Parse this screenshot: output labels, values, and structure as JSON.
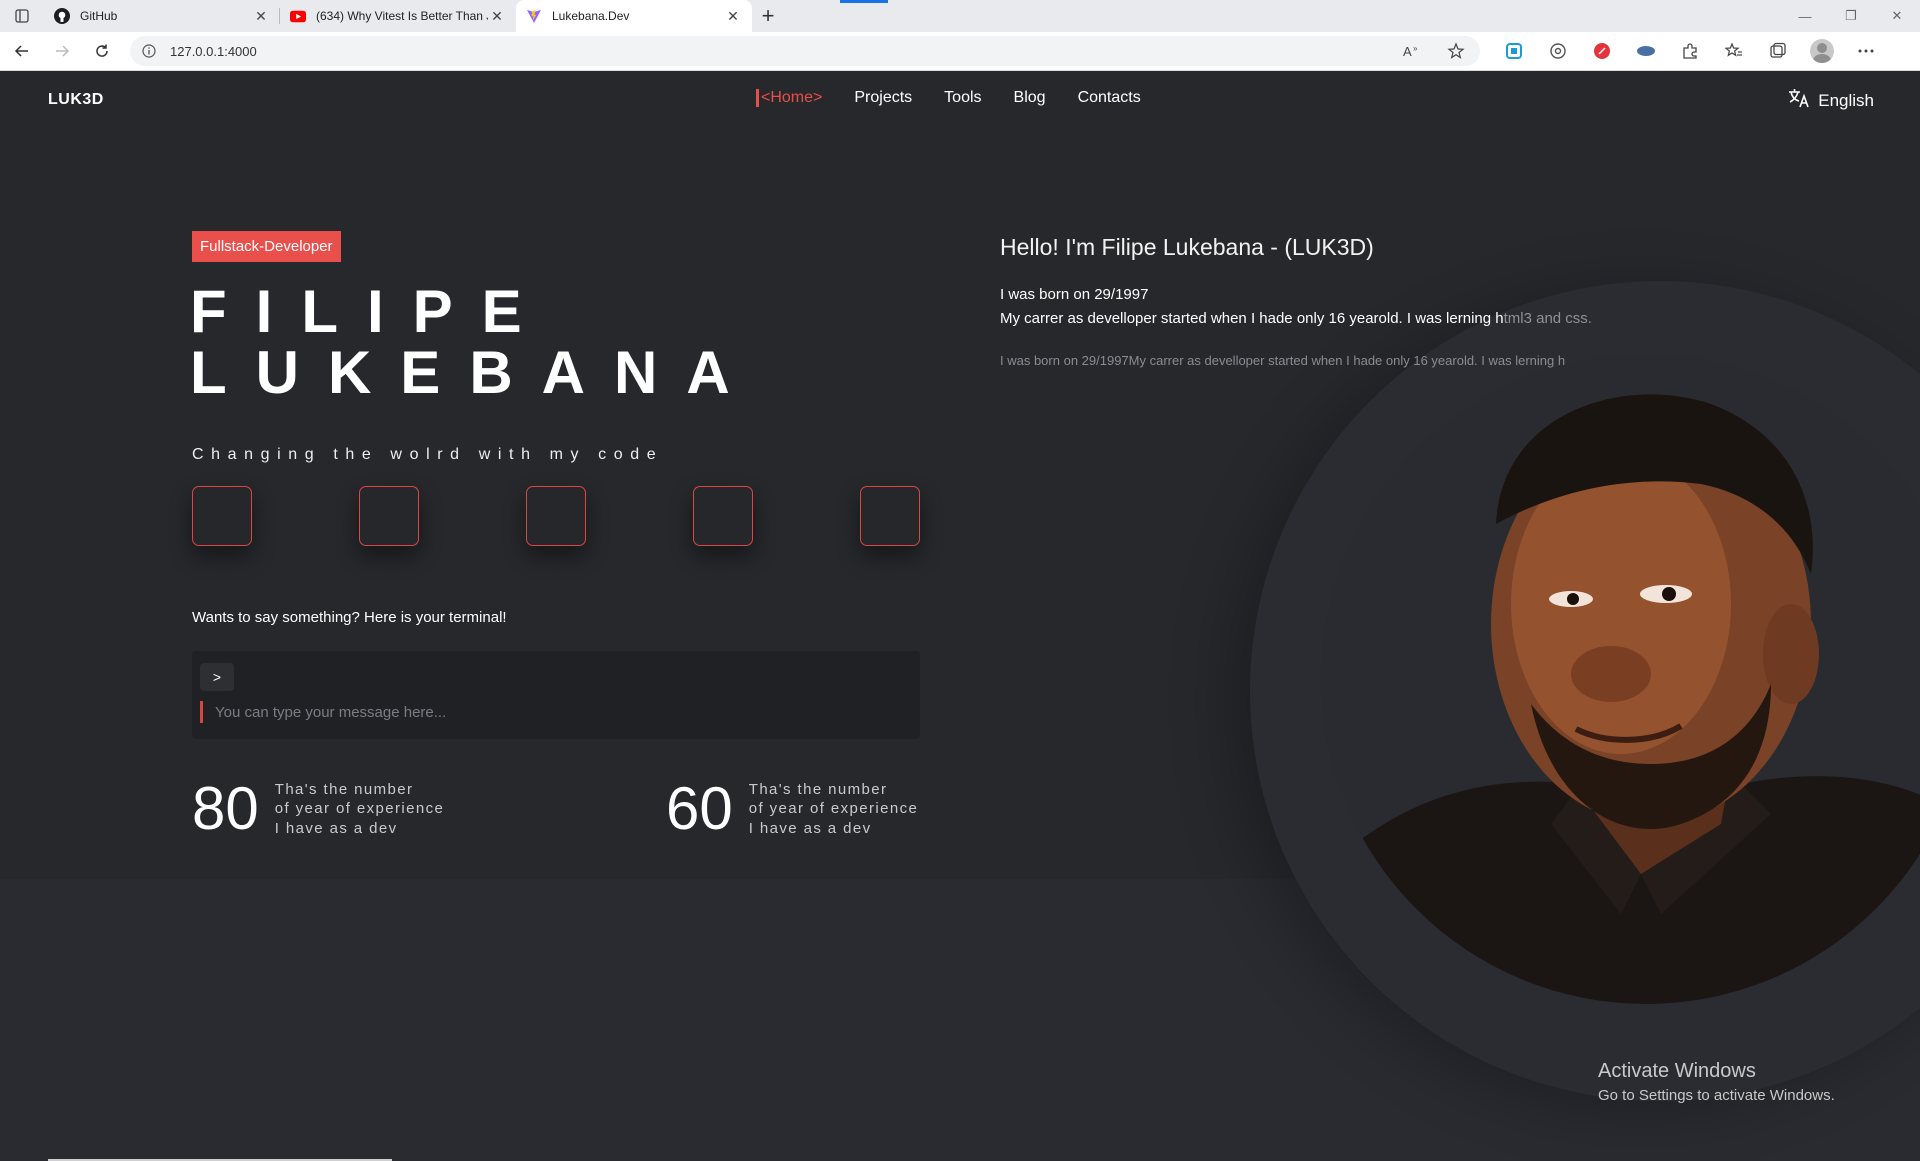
{
  "browser": {
    "tabs": [
      {
        "title": "GitHub",
        "icon": "github-icon"
      },
      {
        "title": "(634) Why Vitest Is Better Than J...",
        "icon": "youtube-icon"
      },
      {
        "title": "Lukebana.Dev",
        "icon": "vite-icon"
      }
    ],
    "active_tab": 2,
    "url": "127.0.0.1:4000"
  },
  "site": {
    "logo": "LUK3D",
    "nav": {
      "items": [
        "<Home>",
        "Projects",
        "Tools",
        "Blog",
        "Contacts"
      ],
      "active": 0
    },
    "language": "English",
    "role_badge": "Fullstack-Developer",
    "name_line1": "FILIPE",
    "name_line2": "LUKEBANA",
    "tagline": "Changing the wolrd with my code",
    "terminal": {
      "prompt_text": "Wants to say something? Here is your terminal!",
      "button_label": ">",
      "placeholder": "You can type your message here..."
    },
    "stats": [
      {
        "number": "80",
        "line1": "Tha's the number",
        "line2": "of year of experience",
        "line3": "I have as a dev"
      },
      {
        "number": "60",
        "line1": "Tha's the number",
        "line2": "of year of experience",
        "line3": "I have as a dev"
      }
    ],
    "hello": "Hello! I'm Filipe Lukebana - (LUK3D)",
    "bio_born": "I was born on 29/1997",
    "bio_career": "My carrer as develloper started when I hade only 16 yearold. I was lerning h",
    "bio_career_faded": "tml3 and css.",
    "bio_repeat": "I was born on 29/1997My carrer as develloper started when I hade only 16 yearold. I was lerning h"
  },
  "os_overlay": {
    "title": "Activate Windows",
    "subtitle": "Go to Settings to activate Windows."
  },
  "colors": {
    "accent": "#e9504c",
    "background": "#26282c",
    "terminal_bg": "#1f2125"
  }
}
